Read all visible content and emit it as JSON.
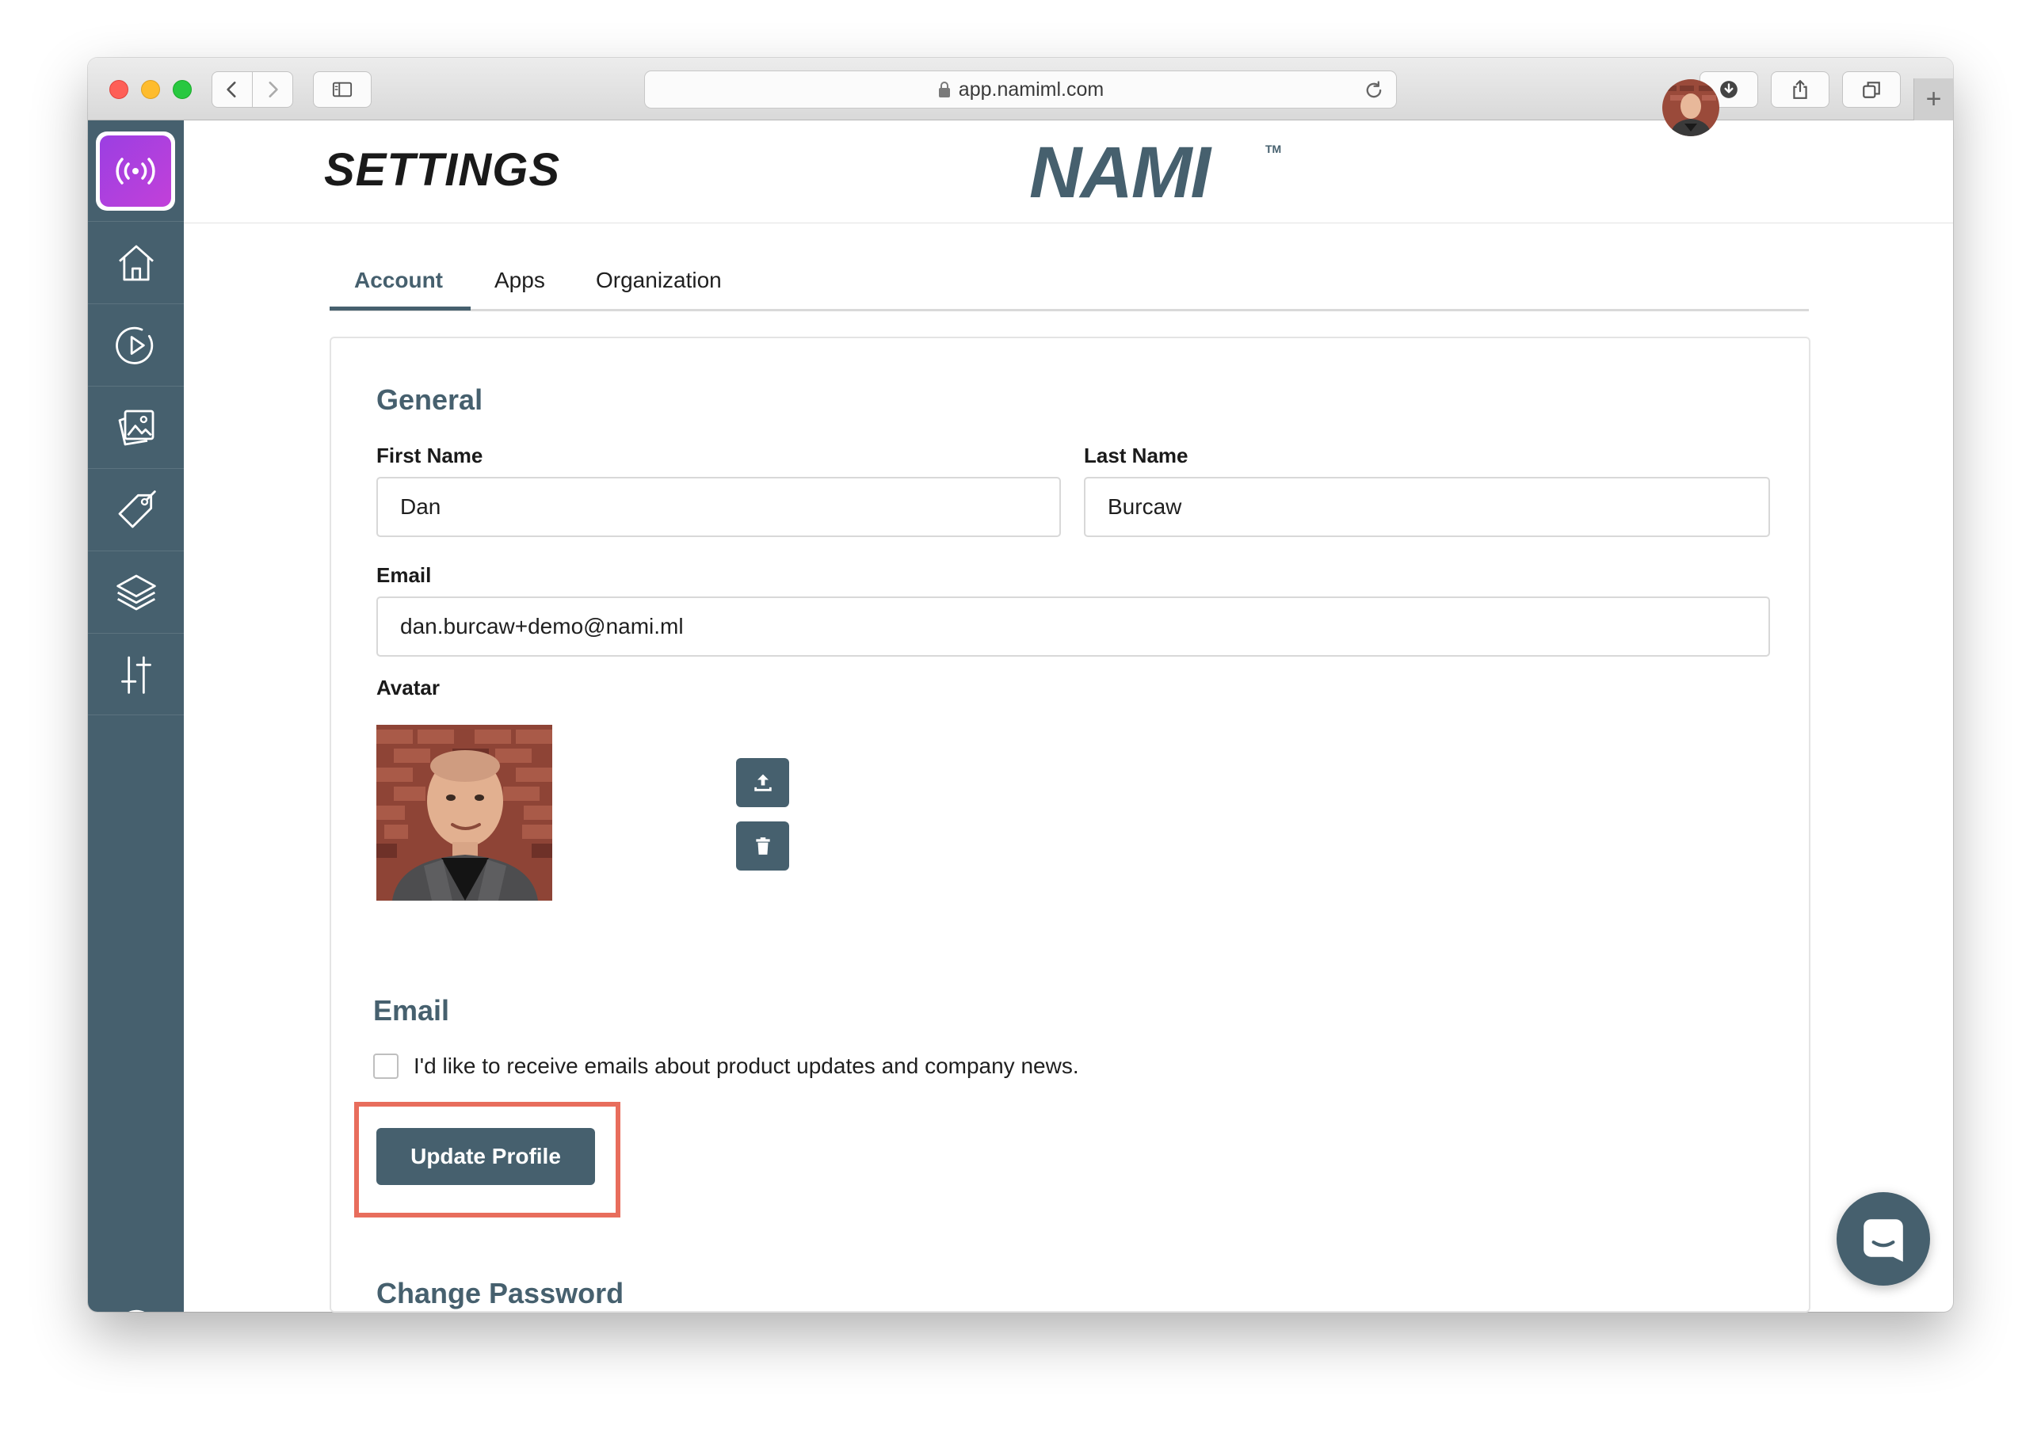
{
  "browser": {
    "url": "app.namiml.com"
  },
  "sidebar": {
    "items": [
      {
        "name": "home",
        "icon": "home-icon"
      },
      {
        "name": "campaigns",
        "icon": "play-circle-icon"
      },
      {
        "name": "paywalls",
        "icon": "gallery-icon"
      },
      {
        "name": "products",
        "icon": "tag-icon"
      },
      {
        "name": "entitlements",
        "icon": "layers-icon"
      },
      {
        "name": "integrations",
        "icon": "sliders-icon"
      }
    ],
    "help_icon": "help-icon"
  },
  "header": {
    "title": "SETTINGS",
    "brand": "NAMI",
    "trademark": "TM"
  },
  "tabs": [
    {
      "label": "Account",
      "active": true
    },
    {
      "label": "Apps",
      "active": false
    },
    {
      "label": "Organization",
      "active": false
    }
  ],
  "general": {
    "title": "General",
    "first_name_label": "First Name",
    "first_name_value": "Dan",
    "last_name_label": "Last Name",
    "last_name_value": "Burcaw",
    "email_label": "Email",
    "email_value": "dan.burcaw+demo@nami.ml",
    "avatar_label": "Avatar"
  },
  "email_prefs": {
    "title": "Email",
    "checkbox_label": "I'd like to receive emails about product updates and company news.",
    "checked": false
  },
  "actions": {
    "update_label": "Update Profile"
  },
  "password": {
    "title": "Change Password"
  },
  "colors": {
    "primary": "#46606e",
    "highlight": "#e86d5c",
    "app_icon": "#b240dc"
  }
}
